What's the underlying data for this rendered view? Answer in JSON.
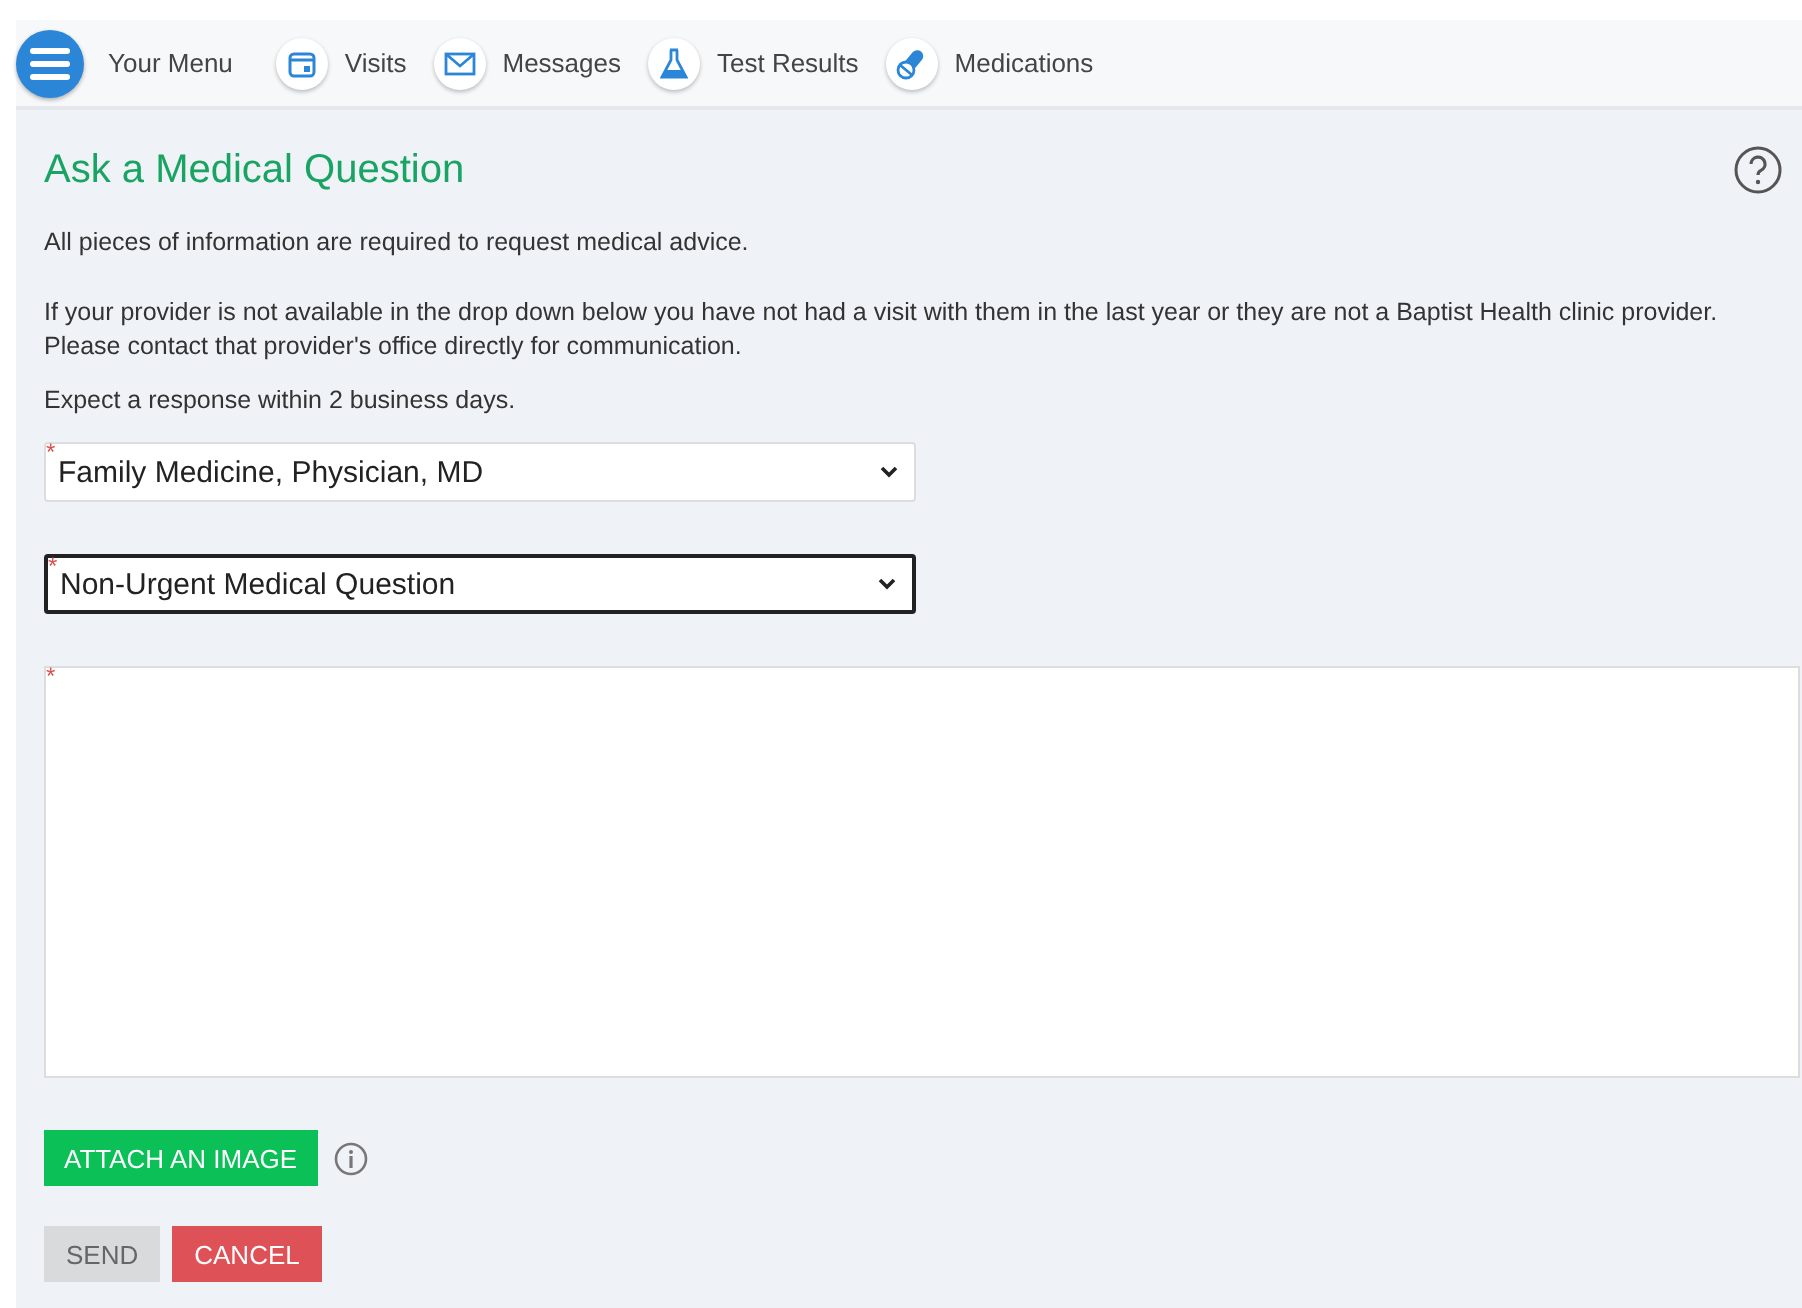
{
  "nav": {
    "menu_label": "Your Menu",
    "items": [
      {
        "kind": "calendar",
        "label": "Visits"
      },
      {
        "kind": "envelope",
        "label": "Messages"
      },
      {
        "kind": "flask",
        "label": "Test Results"
      },
      {
        "kind": "pills",
        "label": "Medications"
      }
    ]
  },
  "page": {
    "title": "Ask a Medical Question",
    "paragraphs": [
      [
        "All pieces of information are required to request medical advice."
      ],
      [
        "If your provider is not available in the drop down below you have not had a visit with them in the last year or they are not a Baptist Health clinic provider.",
        "Please contact that provider's office directly for communication."
      ],
      [
        "Expect a response within 2 business days."
      ]
    ],
    "selects": [
      {
        "required_mark": "*",
        "value": "Family Medicine, Physician, MD",
        "focused": false
      },
      {
        "required_mark": "*",
        "value": "Non-Urgent Medical Question",
        "focused": true
      }
    ],
    "message_field": {
      "required_mark": "*"
    },
    "attach_button": "ATTACH AN IMAGE",
    "buttons": [
      {
        "kind": "send",
        "label": "SEND",
        "disabled": true
      },
      {
        "kind": "cancel",
        "label": "CANCEL",
        "disabled": false
      }
    ]
  }
}
